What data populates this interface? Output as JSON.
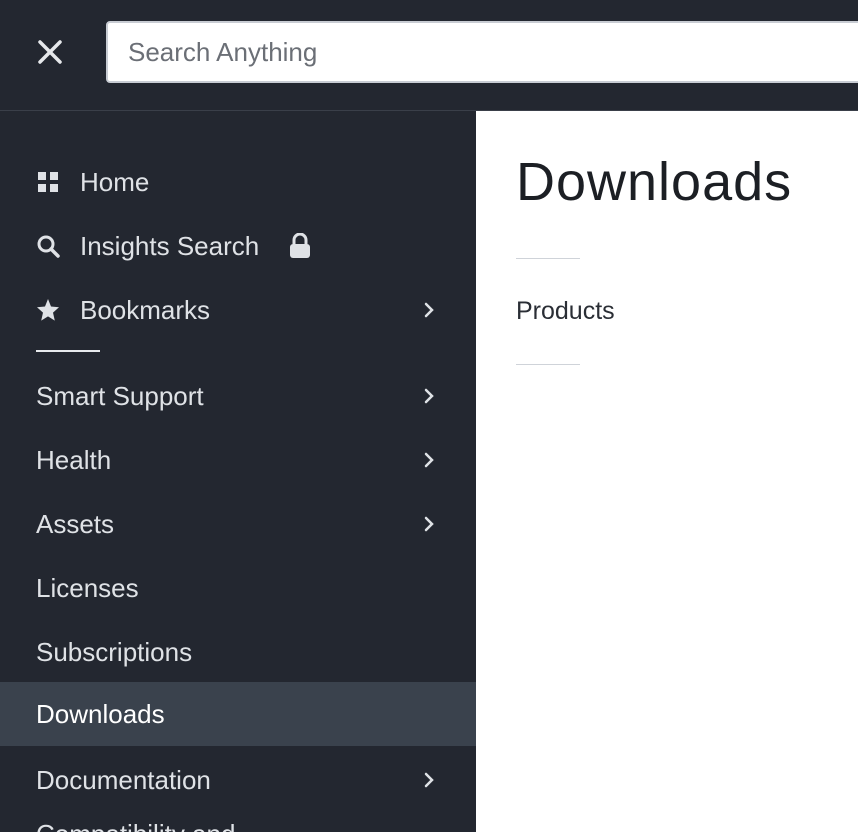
{
  "topbar": {
    "close_icon": "close-icon",
    "search": {
      "placeholder": "Search Anything",
      "value": ""
    }
  },
  "sidebar": {
    "items": [
      {
        "label": "Home",
        "icon": "grid-icon",
        "has_chevron": false
      },
      {
        "label": "Insights Search",
        "icon": "search-icon",
        "locked": true
      },
      {
        "label": "Bookmarks",
        "icon": "star-icon",
        "has_chevron": true
      },
      {
        "label": "Smart Support",
        "has_chevron": true
      },
      {
        "label": "Health",
        "has_chevron": true
      },
      {
        "label": "Assets",
        "has_chevron": true
      },
      {
        "label": "Licenses",
        "has_chevron": false
      },
      {
        "label": "Subscriptions",
        "has_chevron": false
      },
      {
        "label": "Downloads",
        "has_chevron": false,
        "active": true
      },
      {
        "label": "Documentation",
        "has_chevron": true
      },
      {
        "label": "Compatibility and",
        "has_chevron": false
      }
    ]
  },
  "main": {
    "title": "Downloads",
    "links": [
      {
        "label": "Products"
      }
    ]
  },
  "colors": {
    "sidebar_bg": "#232730",
    "active_bg": "#3a424d",
    "text_light": "#dfe2e6"
  }
}
